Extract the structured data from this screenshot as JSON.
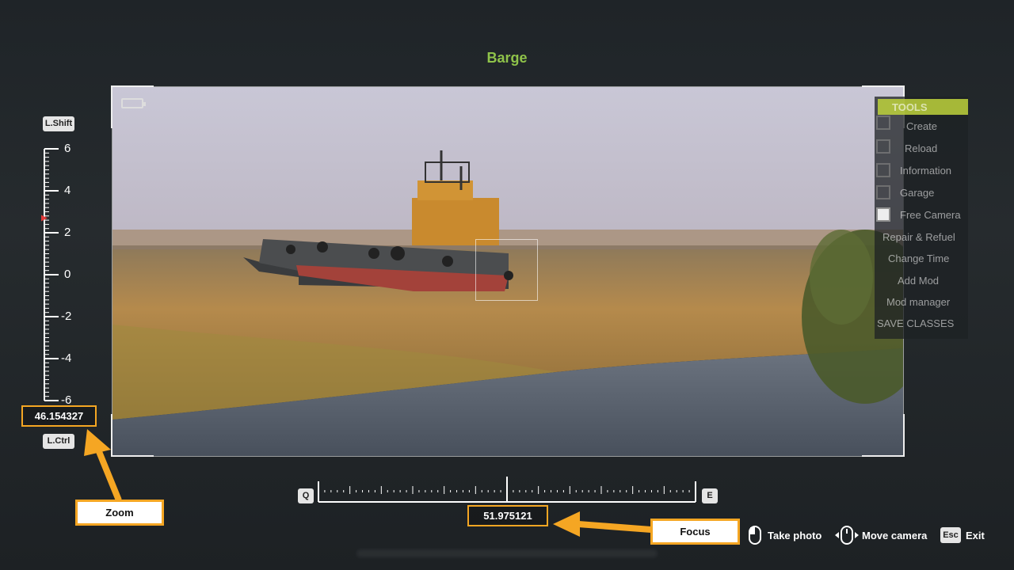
{
  "title": "Barge",
  "zoom": {
    "modifier_up": "L.Shift",
    "modifier_down": "L.Ctrl",
    "scale_labels": [
      "6",
      "4",
      "2",
      "0",
      "-2",
      "-4",
      "-6"
    ],
    "value": "46.154327",
    "indicator_level": 2.7
  },
  "focus": {
    "key_left": "Q",
    "key_right": "E",
    "value": "51.975121"
  },
  "callouts": {
    "zoom": "Zoom",
    "focus": "Focus"
  },
  "hints": {
    "take_photo": "Take photo",
    "move_camera": "Move camera",
    "exit_key": "Esc",
    "exit": "Exit"
  },
  "tools_menu": {
    "header": "TOOLS",
    "items": [
      "Create",
      "Reload",
      "Information",
      "Garage",
      "Free Camera",
      "Repair & Refuel",
      "Change Time",
      "Add Mod",
      "Mod manager",
      "SAVE CLASSES"
    ]
  },
  "colors": {
    "accent": "#8fc34a",
    "highlight": "#f5a623",
    "zoom_indicator": "#e03a3a"
  }
}
